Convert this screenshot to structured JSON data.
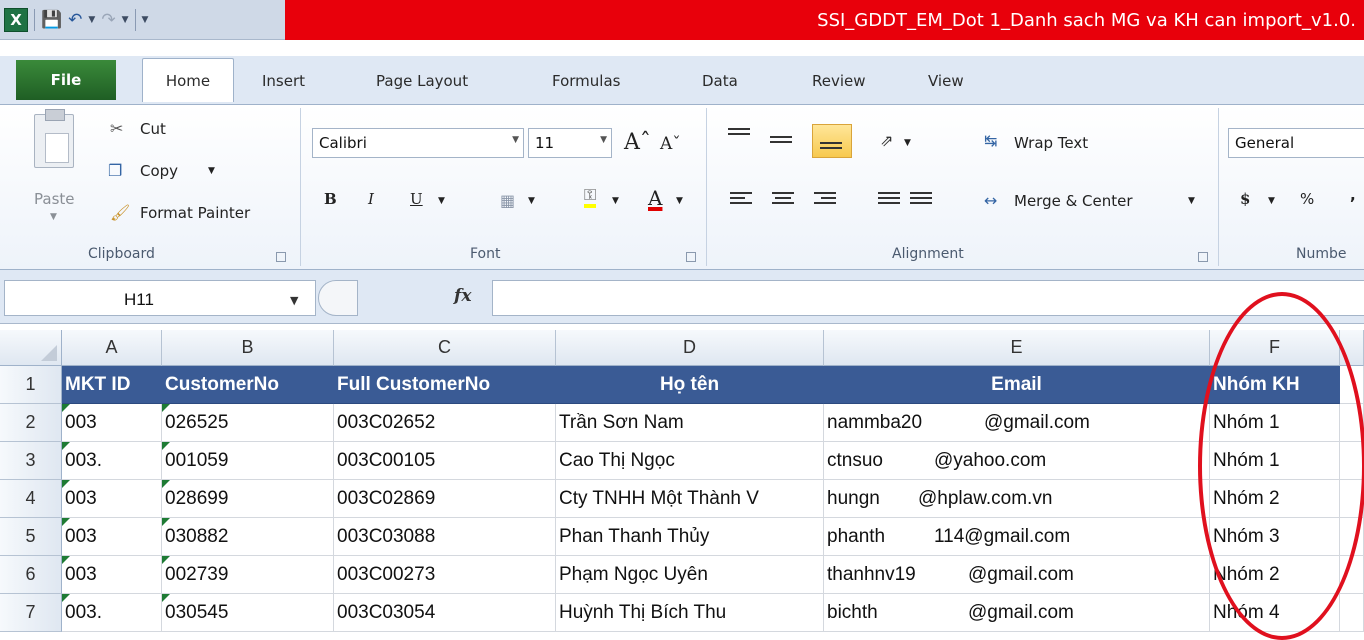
{
  "title_bar": {
    "app_icon": "excel-icon",
    "window_title": "SSI_GDDT_EM_Dot 1_Danh sach MG va KH can import_v1.0."
  },
  "tabs": {
    "file": "File",
    "home": "Home",
    "insert": "Insert",
    "page_layout": "Page Layout",
    "formulas": "Formulas",
    "data": "Data",
    "review": "Review",
    "view": "View"
  },
  "ribbon": {
    "clipboard": {
      "paste": "Paste",
      "cut": "Cut",
      "copy": "Copy",
      "format_painter": "Format Painter",
      "label": "Clipboard"
    },
    "font": {
      "font_name": "Calibri",
      "font_size": "11",
      "label": "Font"
    },
    "alignment": {
      "wrap_text": "Wrap Text",
      "merge_center": "Merge & Center",
      "label": "Alignment"
    },
    "number": {
      "format": "General",
      "label": "Numbe"
    }
  },
  "formula_bar": {
    "name_box": "H11",
    "fx_label": "fx",
    "formula": ""
  },
  "sheet": {
    "columns": [
      "A",
      "B",
      "C",
      "D",
      "E",
      "F"
    ],
    "rows": [
      "1",
      "2",
      "3",
      "4",
      "5",
      "6",
      "7"
    ],
    "header": [
      "MKT ID",
      "CustomerNo",
      "Full CustomerNo",
      "Họ tên",
      "Email",
      "Nhóm KH"
    ],
    "data": [
      [
        "003",
        "026525",
        "003C02652",
        "Trần Sơn Nam",
        "nammba20",
        "@gmail.com",
        "Nhóm 1"
      ],
      [
        "003.",
        "001059",
        "003C00105",
        "Cao Thị Ngọc",
        "ctnsuo",
        "@yahoo.com",
        "Nhóm 1"
      ],
      [
        "003",
        "028699",
        "003C02869",
        "Cty TNHH Một Thành V",
        "hungn",
        "@hplaw.com.vn",
        "Nhóm 2"
      ],
      [
        "003",
        "030882",
        "003C03088",
        "Phan Thanh Thủy",
        "phanth",
        "114@gmail.com",
        "Nhóm 3"
      ],
      [
        "003",
        "002739",
        "003C00273",
        "Phạm Ngọc Uyên",
        "thanhnv19",
        "@gmail.com",
        "Nhóm 2"
      ],
      [
        "003.",
        "030545",
        "003C03054",
        "Huỳnh Thị Bích Thu",
        "bichth",
        "@gmail.com",
        "Nhóm 4"
      ]
    ]
  },
  "annotation": {
    "color": "#e0101e",
    "shape": "red-ellipse-around-column-F"
  }
}
